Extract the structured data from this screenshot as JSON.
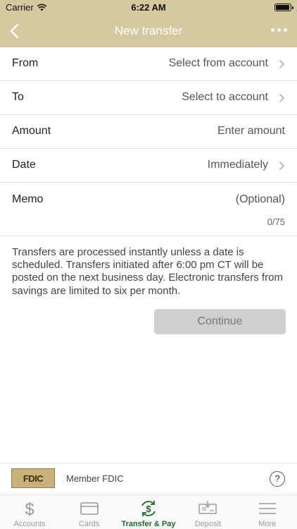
{
  "status": {
    "carrier": "Carrier",
    "time": "6:22 AM",
    "battery_level": 1.0
  },
  "nav": {
    "title": "New transfer"
  },
  "form": {
    "rows": [
      {
        "label": "From",
        "value": "Select from account"
      },
      {
        "label": "To",
        "value": "Select to account"
      },
      {
        "label": "Amount",
        "value": "Enter amount"
      },
      {
        "label": "Date",
        "value": "Immediately"
      }
    ],
    "memo": {
      "label": "Memo",
      "placeholder": "(Optional)",
      "count": "0/75"
    }
  },
  "disclaimer": "Transfers are processed instantly unless a date is scheduled. Transfers initiated after 6:00 pm CT will be posted on the next business day. Electronic transfers from savings are limited to six per month.",
  "continue_label": "Continue",
  "footer": {
    "logo_text": "FDIC",
    "member_text": "Member FDIC",
    "help_symbol": "?"
  },
  "tabs": [
    {
      "label": "Accounts",
      "icon": "dollar-icon",
      "active": false
    },
    {
      "label": "Cards",
      "icon": "card-icon",
      "active": false
    },
    {
      "label": "Transfer & Pay",
      "icon": "transfer-pay-icon",
      "active": true
    },
    {
      "label": "Deposit",
      "icon": "check-deposit-icon",
      "active": false
    },
    {
      "label": "More",
      "icon": "menu-icon",
      "active": false
    }
  ],
  "colors": {
    "header": "#d3c89e",
    "active_tab": "#1d6b2c",
    "inactive_tab": "#9a9a9a",
    "button_disabled": "#cfcfcf"
  }
}
